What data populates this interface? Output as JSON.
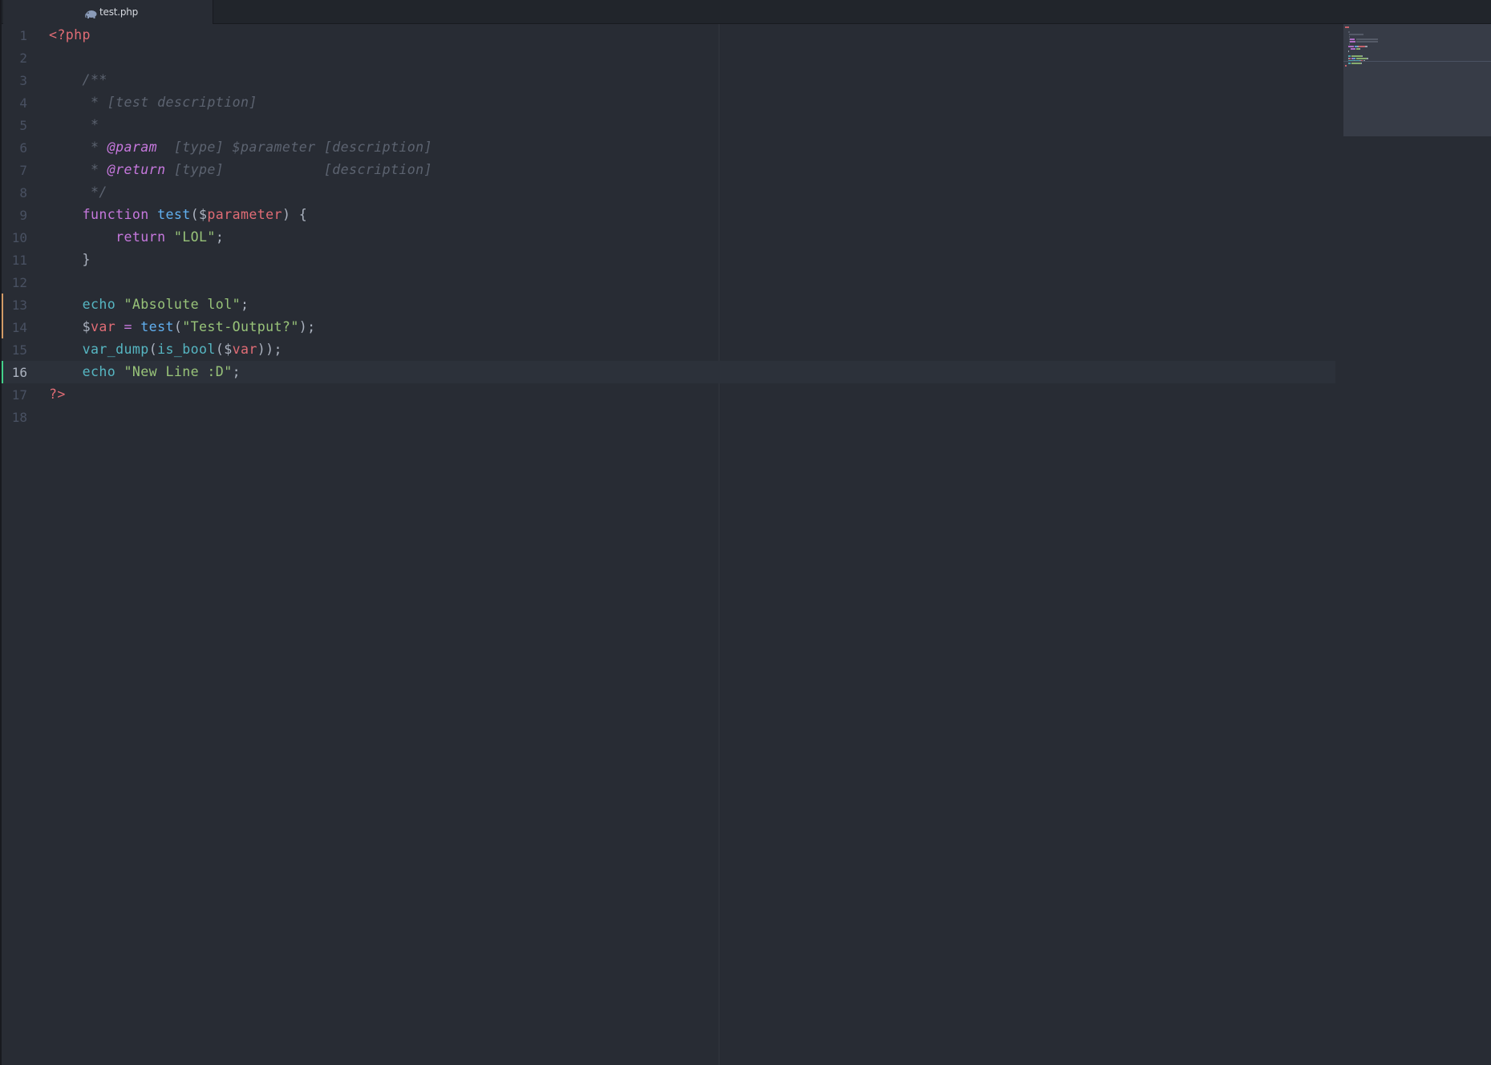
{
  "tab": {
    "title": "test.php",
    "icon": "php-elephant-icon"
  },
  "editor": {
    "active_line": 16,
    "lines": [
      {
        "n": "1",
        "tokens": [
          {
            "t": "<?php",
            "c": "c-php"
          }
        ]
      },
      {
        "n": "2",
        "tokens": []
      },
      {
        "n": "3",
        "tokens": [
          {
            "t": "    /**",
            "c": "c-comment"
          }
        ]
      },
      {
        "n": "4",
        "tokens": [
          {
            "t": "     * [test description]",
            "c": "c-comment"
          }
        ]
      },
      {
        "n": "5",
        "tokens": [
          {
            "t": "     *",
            "c": "c-comment"
          }
        ]
      },
      {
        "n": "6",
        "tokens": [
          {
            "t": "     * ",
            "c": "c-comment"
          },
          {
            "t": "@param",
            "c": "c-tag"
          },
          {
            "t": "  [type] $parameter [description]",
            "c": "c-comment"
          }
        ]
      },
      {
        "n": "7",
        "tokens": [
          {
            "t": "     * ",
            "c": "c-comment"
          },
          {
            "t": "@return",
            "c": "c-tag"
          },
          {
            "t": " [type]            [description]",
            "c": "c-comment"
          }
        ]
      },
      {
        "n": "8",
        "tokens": [
          {
            "t": "     */",
            "c": "c-comment"
          }
        ]
      },
      {
        "n": "9",
        "tokens": [
          {
            "t": "    ",
            "c": "c-plain"
          },
          {
            "t": "function",
            "c": "c-kw"
          },
          {
            "t": " ",
            "c": "c-plain"
          },
          {
            "t": "test",
            "c": "c-fn"
          },
          {
            "t": "(",
            "c": "c-plain"
          },
          {
            "t": "$",
            "c": "c-plain"
          },
          {
            "t": "parameter",
            "c": "c-var"
          },
          {
            "t": ") {",
            "c": "c-plain"
          }
        ]
      },
      {
        "n": "10",
        "tokens": [
          {
            "t": "        ",
            "c": "c-plain"
          },
          {
            "t": "return",
            "c": "c-kw"
          },
          {
            "t": " ",
            "c": "c-plain"
          },
          {
            "t": "\"LOL\"",
            "c": "c-str"
          },
          {
            "t": ";",
            "c": "c-plain"
          }
        ]
      },
      {
        "n": "11",
        "tokens": [
          {
            "t": "    }",
            "c": "c-plain"
          }
        ]
      },
      {
        "n": "12",
        "tokens": []
      },
      {
        "n": "13",
        "git": "#d19a66",
        "tokens": [
          {
            "t": "    ",
            "c": "c-plain"
          },
          {
            "t": "echo",
            "c": "c-builtin"
          },
          {
            "t": " ",
            "c": "c-plain"
          },
          {
            "t": "\"Absolute lol\"",
            "c": "c-str"
          },
          {
            "t": ";",
            "c": "c-plain"
          }
        ]
      },
      {
        "n": "14",
        "git": "#d19a66",
        "tokens": [
          {
            "t": "    ",
            "c": "c-plain"
          },
          {
            "t": "$",
            "c": "c-plain"
          },
          {
            "t": "var",
            "c": "c-var"
          },
          {
            "t": " = ",
            "c": "c-op"
          },
          {
            "t": "test",
            "c": "c-fn"
          },
          {
            "t": "(",
            "c": "c-plain"
          },
          {
            "t": "\"Test-Output?\"",
            "c": "c-str"
          },
          {
            "t": ");",
            "c": "c-plain"
          }
        ]
      },
      {
        "n": "15",
        "tokens": [
          {
            "t": "    ",
            "c": "c-plain"
          },
          {
            "t": "var_dump",
            "c": "c-builtin"
          },
          {
            "t": "(",
            "c": "c-plain"
          },
          {
            "t": "is_bool",
            "c": "c-builtin"
          },
          {
            "t": "(",
            "c": "c-plain"
          },
          {
            "t": "$",
            "c": "c-plain"
          },
          {
            "t": "var",
            "c": "c-var"
          },
          {
            "t": "));",
            "c": "c-plain"
          }
        ]
      },
      {
        "n": "16",
        "git": "#43d08a",
        "tokens": [
          {
            "t": "    ",
            "c": "c-plain"
          },
          {
            "t": "echo",
            "c": "c-builtin"
          },
          {
            "t": " ",
            "c": "c-plain"
          },
          {
            "t": "\"New Line :D\"",
            "c": "c-str"
          },
          {
            "t": ";",
            "c": "c-plain"
          }
        ]
      },
      {
        "n": "17",
        "tokens": [
          {
            "t": "?>",
            "c": "c-php"
          }
        ]
      },
      {
        "n": "18",
        "tokens": []
      }
    ]
  },
  "colors": {
    "background": "#282c34",
    "tabbar": "#21252b",
    "git_modified": "#d19a66",
    "git_added": "#43d08a"
  }
}
